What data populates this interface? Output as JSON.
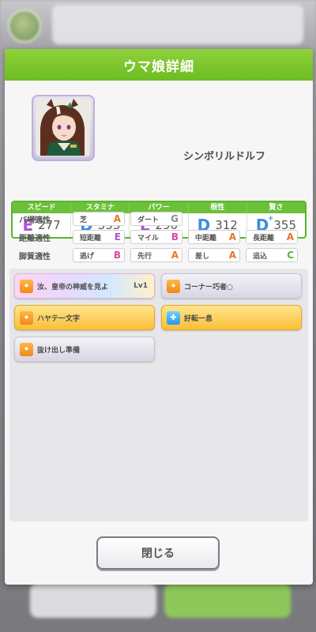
{
  "dialog": {
    "title": "ウマ娘詳細",
    "close_label": "閉じる"
  },
  "character": {
    "name": "シンボリルドルフ"
  },
  "stats": [
    {
      "label": "スピード",
      "grade": "E",
      "plus": "+",
      "value": "277"
    },
    {
      "label": "スタミナ",
      "grade": "D",
      "plus": "+",
      "value": "353"
    },
    {
      "label": "パワー",
      "grade": "E",
      "plus": "+",
      "value": "290"
    },
    {
      "label": "根性",
      "grade": "D",
      "plus": "",
      "value": "312"
    },
    {
      "label": "賢さ",
      "grade": "D",
      "plus": "+",
      "value": "355"
    }
  ],
  "aptitude": {
    "track": {
      "label": "バ場適性",
      "items": [
        {
          "name": "芝",
          "grade": "A"
        },
        {
          "name": "ダート",
          "grade": "G"
        }
      ]
    },
    "distance": {
      "label": "距離適性",
      "items": [
        {
          "name": "短距離",
          "grade": "E"
        },
        {
          "name": "マイル",
          "grade": "B"
        },
        {
          "name": "中距離",
          "grade": "A"
        },
        {
          "name": "長距離",
          "grade": "A"
        }
      ]
    },
    "style": {
      "label": "脚質適性",
      "items": [
        {
          "name": "逃げ",
          "grade": "B"
        },
        {
          "name": "先行",
          "grade": "A"
        },
        {
          "name": "差し",
          "grade": "A"
        },
        {
          "name": "追込",
          "grade": "C"
        }
      ]
    }
  },
  "skills": [
    {
      "name": "汝、皇帝の神威を見よ",
      "level": "Lv1",
      "style": "rainbow",
      "icon": "orange"
    },
    {
      "name": "コーナー巧者○",
      "level": "",
      "style": "white",
      "icon": "orange"
    },
    {
      "name": "ハヤテ一文字",
      "level": "",
      "style": "gold",
      "icon": "orange"
    },
    {
      "name": "好転一息",
      "level": "",
      "style": "gold",
      "icon": "blue"
    },
    {
      "name": "抜け出し準備",
      "level": "",
      "style": "white",
      "icon": "orange"
    }
  ],
  "colors": {
    "header_green": "#6bbd22",
    "grade_e": "#b050d6",
    "grade_d": "#3f8ee0"
  }
}
